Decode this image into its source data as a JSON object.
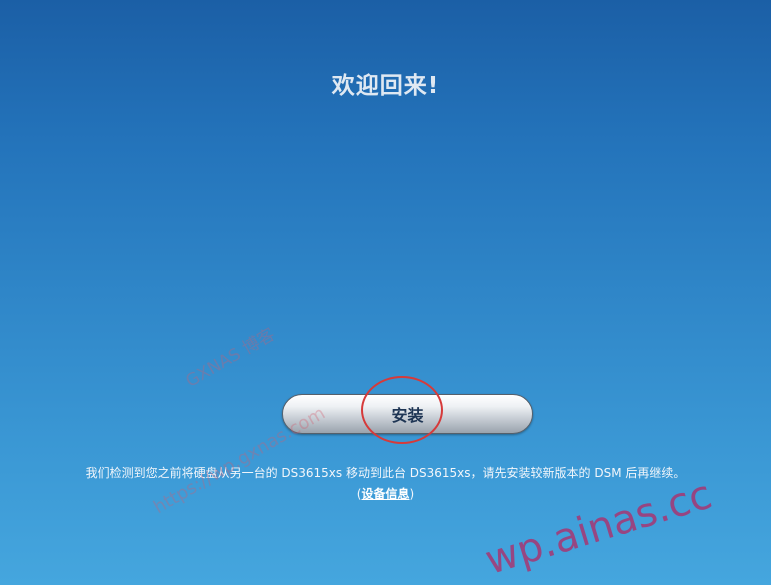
{
  "welcome": {
    "title": "欢迎回来!"
  },
  "install": {
    "label": "安装"
  },
  "message": {
    "text": "我们检测到您之前将硬盘从另一台的 DS3615xs 移动到此台 DS3615xs，请先安装较新版本的 DSM 后再继续。",
    "info_open": "(",
    "info_link": "设备信息",
    "info_close": ")"
  },
  "watermarks": {
    "blog": "GXNAS 博客",
    "site": "https://wp.gxnas.com",
    "ainas": "wp.ainas.cc"
  },
  "colors": {
    "background_top": "#1b5fa6",
    "background_bottom": "#45a6de",
    "highlight_circle": "#d63a3a"
  }
}
